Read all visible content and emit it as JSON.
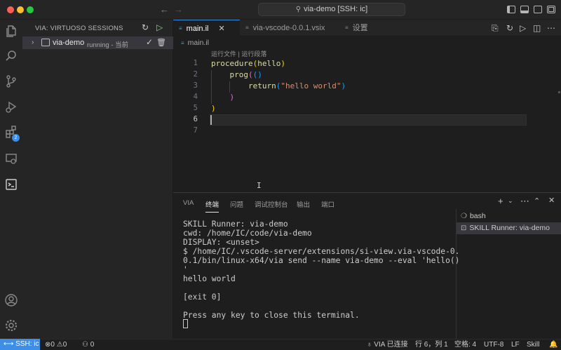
{
  "titlebar": {
    "command_center": "via-demo [SSH: ic]"
  },
  "activity": {
    "extensions_badge": "2"
  },
  "sidebar": {
    "title": "VIA: VIRTUOSO SESSIONS",
    "session": {
      "name": "via-demo",
      "description": "running - 当前"
    }
  },
  "tabs": [
    {
      "label": "main.il"
    },
    {
      "label": "via-vscode-0.0.1.vsix"
    },
    {
      "label": "设置"
    }
  ],
  "editor": {
    "breadcrumb": "main.il",
    "codelens": "运行文件 | 运行段落",
    "line_numbers": [
      "1",
      "2",
      "3",
      "4",
      "5",
      "6",
      "7"
    ],
    "lines": [
      {
        "a": "procedure(",
        "b": "hello",
        "c": ")"
      },
      {
        "a": "    prog(",
        "b": "()",
        "c": ""
      },
      {
        "a": "        return(",
        "b": "\"hello world\"",
        "c": ")"
      },
      {
        "a": "    )",
        "b": "",
        "c": ""
      },
      {
        "a": ")",
        "b": "",
        "c": ""
      }
    ],
    "colors": {
      "keyword": "#dcdcaa",
      "bracket1": "#ffd700",
      "bracket2": "#da70d6",
      "bracket3": "#179fff",
      "string": "#ce9178",
      "param": "#9cdcfe"
    }
  },
  "panel": {
    "tabs": [
      "VIA",
      "终端",
      "问题",
      "调试控制台",
      "输出",
      "端口"
    ],
    "active_tab": "终端",
    "terminal_lines": [
      "SKILL Runner: via-demo",
      "cwd: /home/IC/code/via-demo",
      "DISPLAY: <unset>",
      "$ /home/IC/.vscode-server/extensions/si-view.via-vscode-0.",
      "0.1/bin/linux-x64/via send --name via-demo --eval 'hello()",
      "'",
      "hello world",
      "",
      "[exit 0]",
      "",
      "Press any key to close this terminal."
    ],
    "terminals": [
      {
        "label": "bash",
        "icon": "bash-icon"
      },
      {
        "label": "SKILL Runner: via-demo",
        "icon": "terminal-icon"
      }
    ]
  },
  "statusbar": {
    "remote": "SSH: ic",
    "errors": "0",
    "warnings": "0",
    "ports": "0",
    "via_status": "VIA 已连接",
    "position": "行 6，列 1",
    "indent": "空格: 4",
    "encoding": "UTF-8",
    "eol": "LF",
    "language": "Skill"
  }
}
